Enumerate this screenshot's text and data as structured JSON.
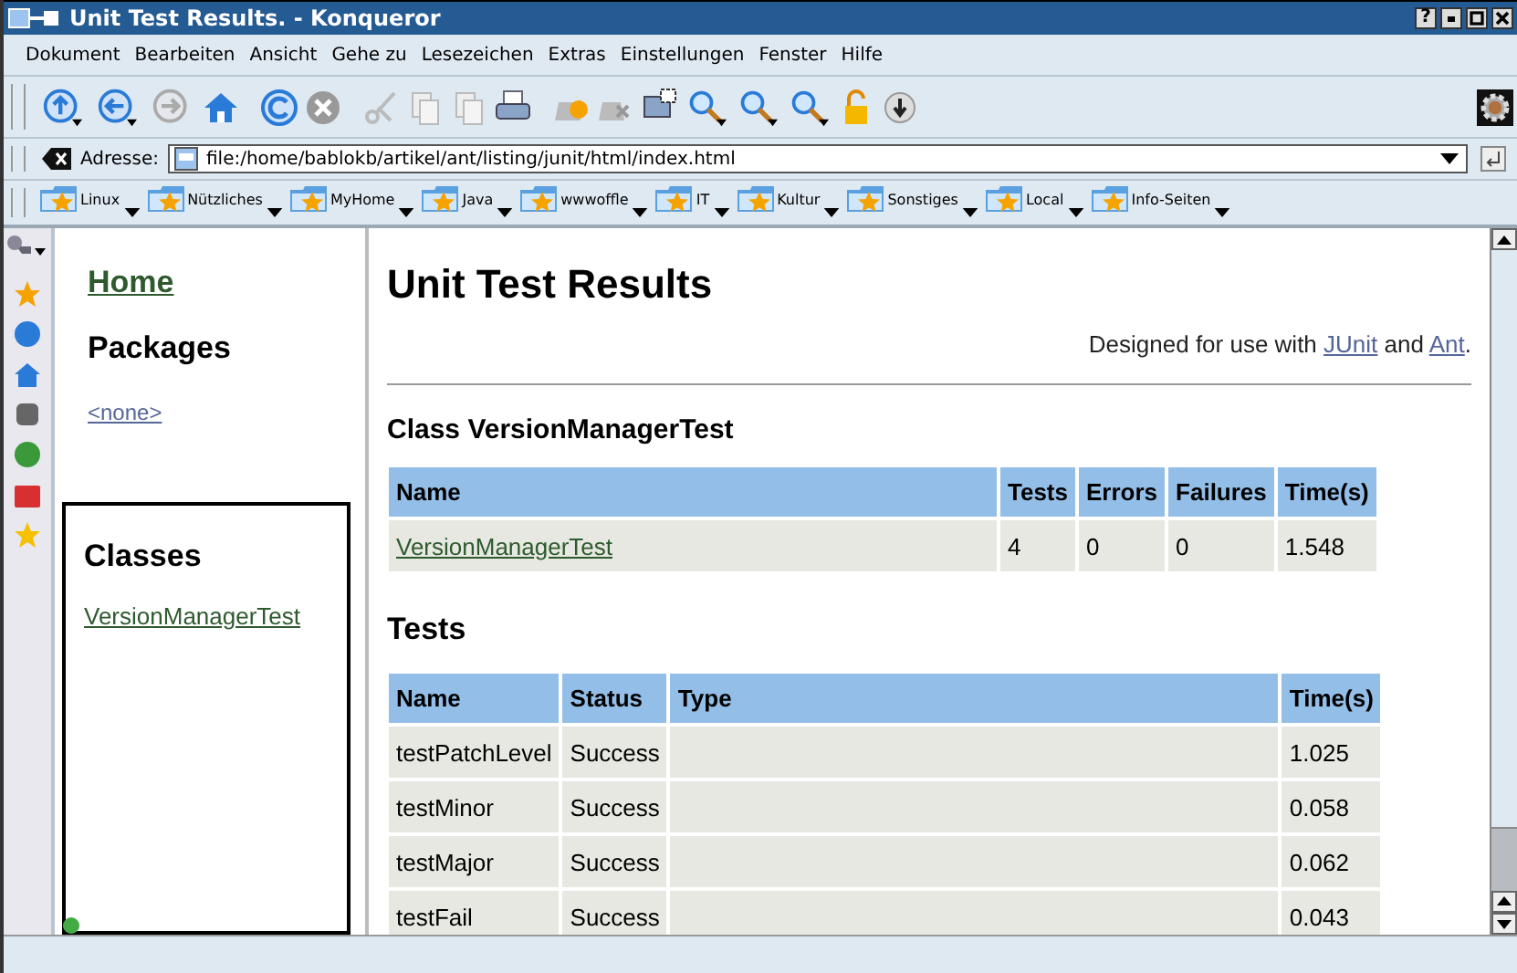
{
  "window": {
    "title": "Unit Test Results. - Konqueror",
    "help_button": "?"
  },
  "menu": [
    "Dokument",
    "Bearbeiten",
    "Ansicht",
    "Gehe zu",
    "Lesezeichen",
    "Extras",
    "Einstellungen",
    "Fenster",
    "Hilfe"
  ],
  "address_bar": {
    "label": "Adresse:",
    "value": "file:/home/bablokb/artikel/ant/listing/junit/html/index.html"
  },
  "bookmarks": [
    "Linux",
    "Nützliches",
    "MyHome",
    "Java",
    "wwwoffle",
    "IT",
    "Kultur",
    "Sonstiges",
    "Local",
    "Info-Seiten"
  ],
  "nav_frame": {
    "home_link": "Home",
    "packages_heading": "Packages",
    "packages": [
      "<none>"
    ],
    "classes_heading": "Classes",
    "classes": [
      "VersionManagerTest"
    ]
  },
  "main": {
    "title": "Unit Test Results",
    "designed_text": "Designed for use with",
    "junit_link": "JUnit",
    "and_text": "and",
    "ant_link": "Ant",
    "period": ".",
    "class_heading": "Class VersionManagerTest",
    "class_table": {
      "columns": [
        "Name",
        "Tests",
        "Errors",
        "Failures",
        "Time(s)"
      ],
      "rows": [
        {
          "name": "VersionManagerTest",
          "tests": "4",
          "errors": "0",
          "failures": "0",
          "time": "1.548"
        }
      ]
    },
    "tests_heading": "Tests",
    "tests_table": {
      "columns": [
        "Name",
        "Status",
        "Type",
        "Time(s)"
      ],
      "rows": [
        {
          "name": "testPatchLevel",
          "status": "Success",
          "time": "1.025"
        },
        {
          "name": "testMinor",
          "status": "Success",
          "time": "0.058"
        },
        {
          "name": "testMajor",
          "status": "Success",
          "time": "0.062"
        },
        {
          "name": "testFail",
          "status": "Success",
          "time": "0.043"
        }
      ]
    }
  }
}
